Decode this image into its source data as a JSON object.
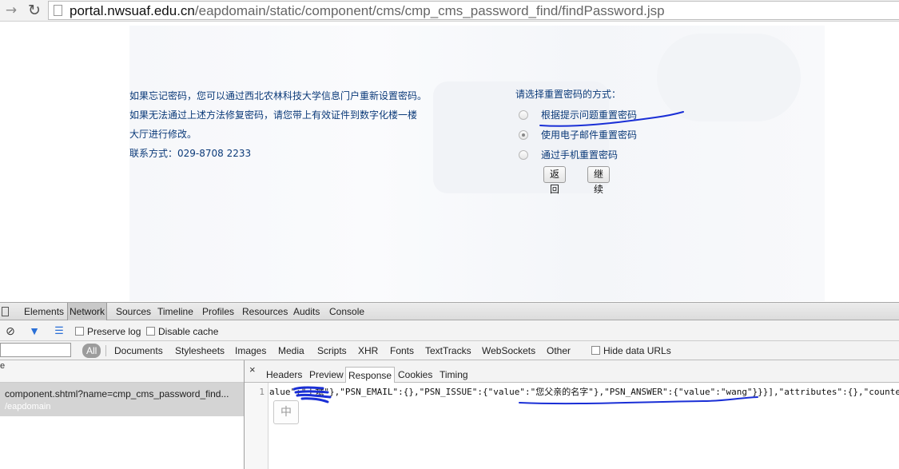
{
  "browser": {
    "url_host": "portal.nwsuaf.edu.cn",
    "url_path": "/eapdomain/static/component/cms/cmp_cms_password_find/findPassword.jsp"
  },
  "page": {
    "info_lines": [
      "如果忘记密码，您可以通过西北农林科技大学信息门户重新设置密码。",
      "如果无法通过上述方法修复密码，请您带上有效证件到数字化楼一楼",
      "大厅进行修改。",
      "联系方式：029-8708 2233"
    ],
    "options_title": "请选择重置密码的方式：",
    "options": [
      {
        "label": "根据提示问题重置密码",
        "checked": false
      },
      {
        "label": "使用电子邮件重置密码",
        "checked": true
      },
      {
        "label": "通过手机重置密码",
        "checked": false
      }
    ],
    "back_label": "返回",
    "continue_label": "继续"
  },
  "devtools": {
    "tabs": [
      "Elements",
      "Network",
      "Sources",
      "Timeline",
      "Profiles",
      "Resources",
      "Audits",
      "Console"
    ],
    "active_tab": "Network",
    "preserve_log": "Preserve log",
    "disable_cache": "Disable cache",
    "type_all": "All",
    "types": [
      "Documents",
      "Stylesheets",
      "Images",
      "Media",
      "Scripts",
      "XHR",
      "Fonts",
      "TextTracks",
      "WebSockets",
      "Other"
    ],
    "hide_data_urls": "Hide data URLs",
    "column_header": "e",
    "request": {
      "name": "component.shtml?name=cmp_cms_password_find...",
      "path": "/eapdomain"
    },
    "detail_tabs": [
      "Headers",
      "Preview",
      "Response",
      "Cookies",
      "Timing"
    ],
    "active_detail_tab": "Response",
    "line_number": "1",
    "response_text": "alue\":\"王斌\"},\"PSN_EMAIL\":{},\"PSN_ISSUE\":{\"value\":\"您父亲的名字\"},\"PSN_ANSWER\":{\"value\":\"wang\"}}}],\"attributes\":{},\"counte",
    "ime_label": "中",
    "close_label": "×"
  },
  "colors": {
    "link_text": "#0b3a79",
    "ink": "#1a2fd6"
  }
}
